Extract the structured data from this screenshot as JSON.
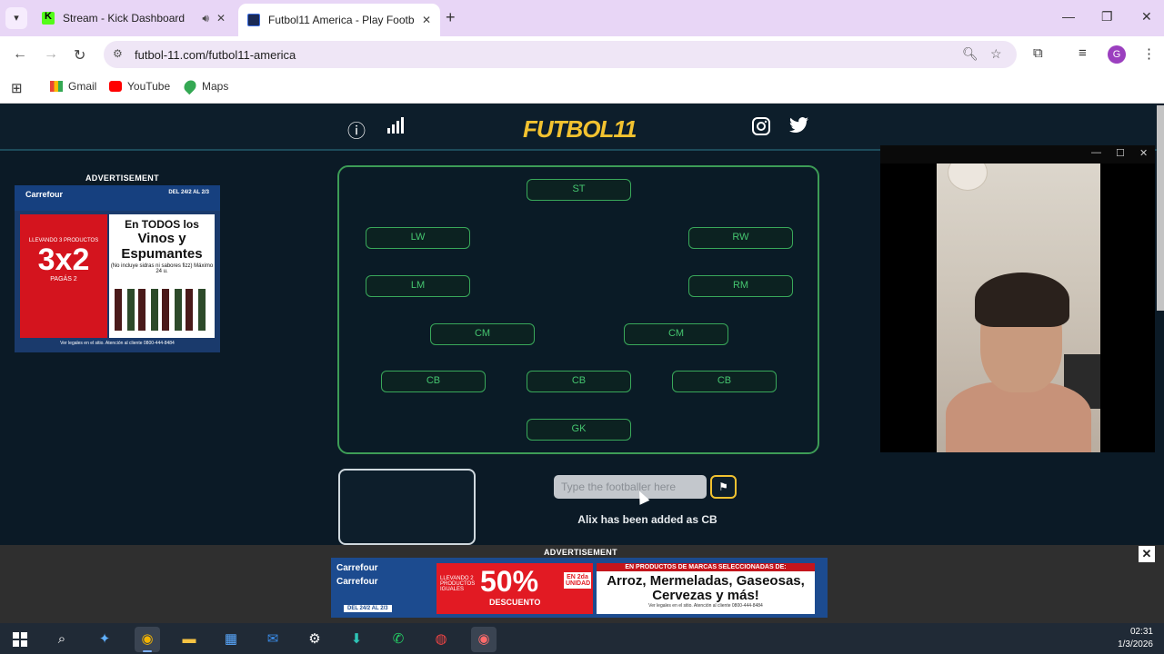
{
  "browser": {
    "tabs": [
      {
        "title": "Stream - Kick Dashboard",
        "favicon": "kick-icon"
      },
      {
        "title": "Futbol11 America - Play Footba",
        "favicon": "futbol11-icon"
      }
    ],
    "url": "futbol-11.com/futbol11-america",
    "bookmarks": [
      "Gmail",
      "YouTube",
      "Maps"
    ],
    "profile_initial": "G"
  },
  "site": {
    "logo": "FUTBOL11",
    "accent_color": "#f2c230",
    "pitch_color": "#3d9c56",
    "header_icons": [
      "info-icon",
      "stats-icon",
      "instagram-icon",
      "twitter-icon"
    ]
  },
  "ads": {
    "label": "ADVERTISEMENT",
    "side_ad": {
      "brand": "Carrefour",
      "date": "DEL 24/2 AL 2/3",
      "promo_small": "LLEVANDO 3 PRODUCTOS",
      "promo_big": "3x2",
      "promo_pay": "PAGÁS 2",
      "headline_1": "En TODOS los",
      "headline_2": "Vinos y Espumantes",
      "note": "(No incluye sidras ni sabores fizz) Máximo 24 u.",
      "footer": "Ver legales en el sitio. Atención al cliente 0800-444-8484"
    },
    "bottom_ad": {
      "brand": "Carrefour",
      "date": "DEL 24/2 AL 2/3",
      "pre": "LLEVANDO 2 PRODUCTOS IGUALES",
      "percent": "50%",
      "desc": "DESCUENTO",
      "unit": "EN 2da UNIDAD",
      "header": "EN PRODUCTOS DE MARCAS SELECCIONADAS DE:",
      "text": "Arroz, Mermeladas, Gaseosas, Cervezas y más!",
      "footer": "Ver legales en el sitio. Atención al cliente 0800-444-8484"
    }
  },
  "pitch": {
    "positions": {
      "st": "ST",
      "lw": "LW",
      "rw": "RW",
      "lm": "LM",
      "rm": "RM",
      "cm_left": "CM",
      "cm_right": "CM",
      "cb_left": "CB",
      "cb_center": "CB",
      "cb_right": "CB",
      "gk": "GK"
    }
  },
  "guess": {
    "placeholder": "Type the footballer here",
    "status": "Alix has been added as CB"
  },
  "taskbar": {
    "time": "02:31",
    "date": "1/3/2026"
  }
}
